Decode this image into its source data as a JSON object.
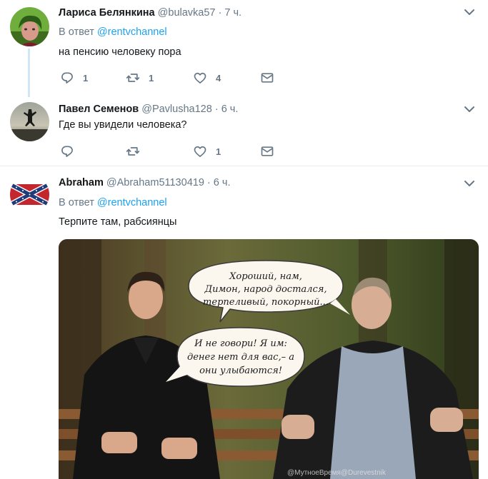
{
  "tweets": [
    {
      "name": "Лариса Белянкина",
      "handle": "@bulavka57",
      "dot": "·",
      "time": "7 ч.",
      "reply_prefix": "В ответ",
      "reply_to": "@rentvchannel",
      "text": "на пенсию человеку пора",
      "replies": "1",
      "retweets": "1",
      "likes": "4"
    },
    {
      "name": "Павел Семенов",
      "handle": "@Pavlusha128",
      "dot": "·",
      "time": "6 ч.",
      "text": "Где вы увидели человека?",
      "replies": "",
      "retweets": "",
      "likes": "1"
    },
    {
      "name": "Abraham",
      "handle": "@Abraham51130419",
      "dot": "·",
      "time": "6 ч.",
      "reply_prefix": "В ответ",
      "reply_to": "@rentvchannel",
      "text": "Терпите там, рабсиянцы",
      "image": {
        "bubble_top": [
          "Хороший, нам,",
          "Димон, народ достался,",
          "терпеливый, покорный..."
        ],
        "bubble_bottom": [
          "И не говори! Я им:",
          "денег нет для вас,– а",
          "они улыбаются!"
        ],
        "watermark": "@МутноеВремя@Durevestnik"
      }
    }
  ],
  "colors": {
    "accent": "#1da1f2",
    "muted": "#657786",
    "thread_line": "#cfe7f7"
  },
  "icons": {
    "reply": "reply-icon",
    "retweet": "retweet-icon",
    "like": "heart-icon",
    "dm": "envelope-icon",
    "menu": "chevron-down-icon"
  }
}
